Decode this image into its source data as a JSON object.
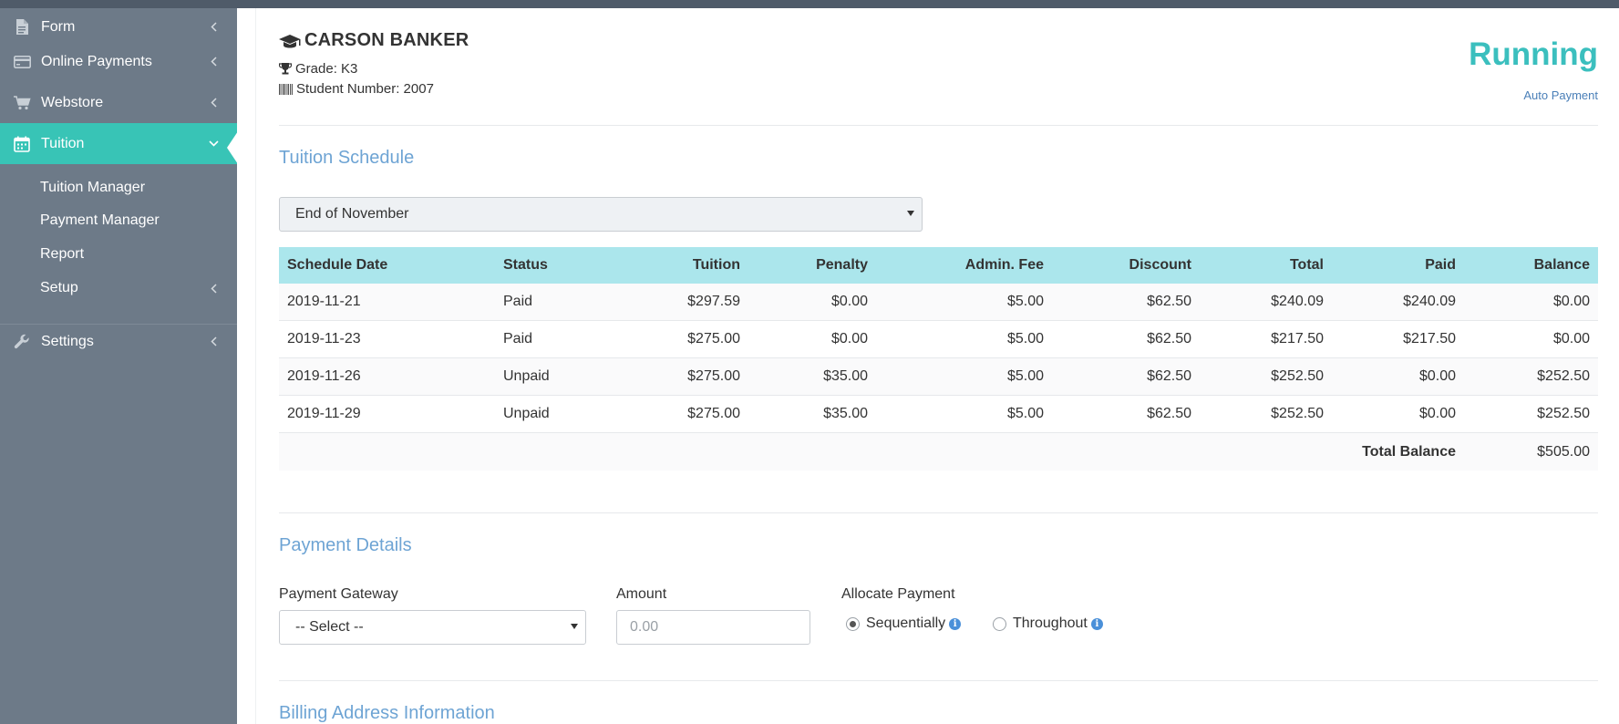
{
  "sidebar": {
    "items": [
      {
        "label": "Form",
        "icon": "file-icon"
      },
      {
        "label": "Online Payments",
        "icon": "credit-card-icon"
      },
      {
        "label": "Webstore",
        "icon": "cart-icon"
      },
      {
        "label": "Tuition",
        "icon": "calendar-icon",
        "active": true
      },
      {
        "label": "Settings",
        "icon": "wrench-icon"
      }
    ],
    "subitems": [
      "Tuition Manager",
      "Payment Manager",
      "Report",
      "Setup"
    ]
  },
  "student": {
    "name": "CARSON BANKER",
    "grade": "Grade: K3",
    "number": "Student Number: 2007"
  },
  "status": {
    "label": "Running",
    "sublabel": "Auto Payment",
    "color": "#3bbfbe"
  },
  "schedule": {
    "title": "Tuition Schedule",
    "selected": "End of November",
    "columns": [
      "Schedule Date",
      "Status",
      "Tuition",
      "Penalty",
      "Admin. Fee",
      "Discount",
      "Total",
      "Paid",
      "Balance"
    ],
    "rows": [
      [
        "2019-11-21",
        "Paid",
        "$297.59",
        "$0.00",
        "$5.00",
        "$62.50",
        "$240.09",
        "$240.09",
        "$0.00"
      ],
      [
        "2019-11-23",
        "Paid",
        "$275.00",
        "$0.00",
        "$5.00",
        "$62.50",
        "$217.50",
        "$217.50",
        "$0.00"
      ],
      [
        "2019-11-26",
        "Unpaid",
        "$275.00",
        "$35.00",
        "$5.00",
        "$62.50",
        "$252.50",
        "$0.00",
        "$252.50"
      ],
      [
        "2019-11-29",
        "Unpaid",
        "$275.00",
        "$35.00",
        "$5.00",
        "$62.50",
        "$252.50",
        "$0.00",
        "$252.50"
      ]
    ],
    "total_label": "Total Balance",
    "total_value": "$505.00",
    "header_color": "#abe6ec"
  },
  "payment": {
    "title": "Payment Details",
    "gateway_label": "Payment Gateway",
    "gateway_value": "-- Select --",
    "amount_label": "Amount",
    "amount_placeholder": "0.00",
    "allocate_label": "Allocate Payment",
    "options": [
      "Sequentially",
      "Throughout"
    ],
    "selected_option": "Sequentially"
  },
  "billing": {
    "title": "Billing Address Information"
  },
  "colors": {
    "sidebar": "#6d7a88",
    "active": "#38c4b6",
    "section_title": "#6ea4d4"
  }
}
